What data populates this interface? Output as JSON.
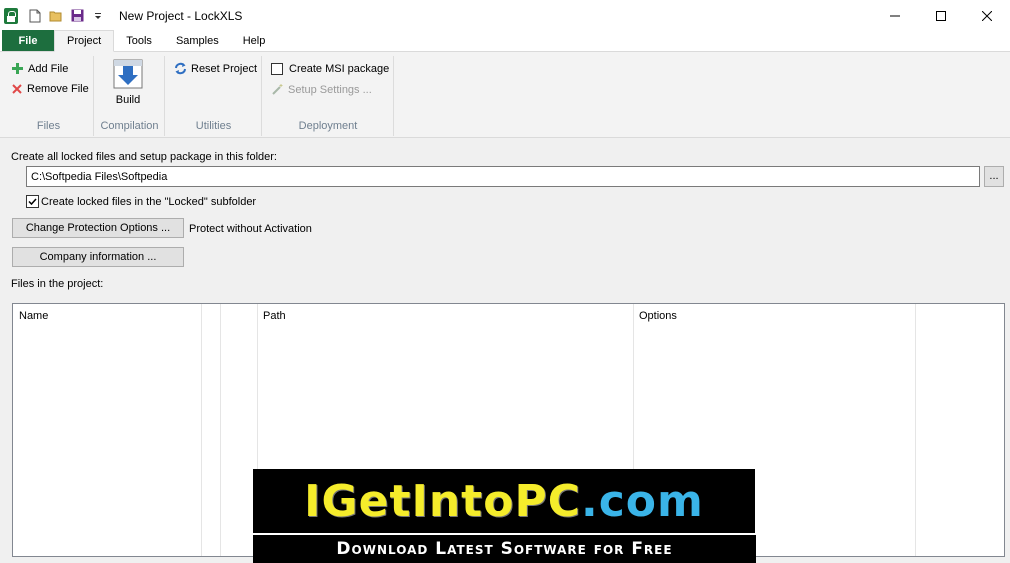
{
  "window": {
    "title": "New Project - LockXLS"
  },
  "ribbon_tabs": [
    {
      "label": "File"
    },
    {
      "label": "Project"
    },
    {
      "label": "Tools"
    },
    {
      "label": "Samples"
    },
    {
      "label": "Help"
    }
  ],
  "ribbon": {
    "files": {
      "label": "Files",
      "add_file": "Add File",
      "remove_file": "Remove File"
    },
    "compilation": {
      "label": "Compilation",
      "build": "Build"
    },
    "utilities": {
      "label": "Utilities",
      "reset_project": "Reset Project"
    },
    "deployment": {
      "label": "Deployment",
      "create_msi": "Create MSI package",
      "setup_settings": "Setup Settings ..."
    }
  },
  "main": {
    "folder_label": "Create all locked files and setup package in this folder:",
    "folder_path": "C:\\Softpedia Files\\Softpedia",
    "browse_label": "...",
    "locked_subfolder_label": "Create locked files in the \"Locked\" subfolder",
    "locked_subfolder_checked": true,
    "change_protection_label": "Change Protection Options ...",
    "protection_status": "Protect without Activation",
    "company_info_label": "Company information ...",
    "files_label": "Files in the project:"
  },
  "file_list": {
    "columns": [
      {
        "label": "Name"
      },
      {
        "label": ""
      },
      {
        "label": ""
      },
      {
        "label": "Path"
      },
      {
        "label": "Options"
      },
      {
        "label": ""
      }
    ],
    "rows": []
  },
  "watermark": {
    "main_left": "IGetIntoPC",
    "main_dot": ".com",
    "tagline": "Download Latest Software for Free"
  },
  "colors": {
    "file_tab": "#1d6e3e",
    "banner_yellow": "#f5ec2b",
    "banner_blue": "#3ab4e8",
    "group_label": "#6f7f8f"
  }
}
